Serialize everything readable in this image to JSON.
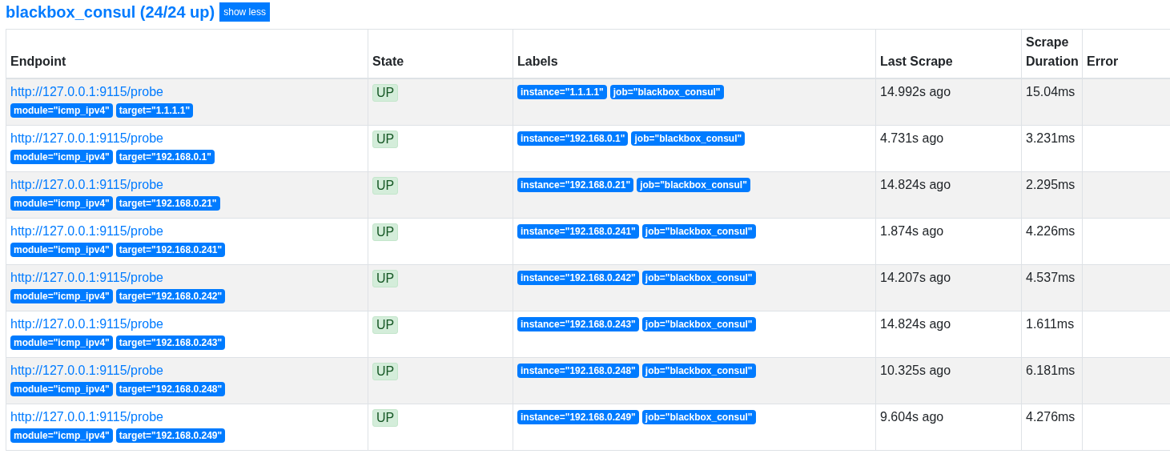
{
  "header": {
    "title": "blackbox_consul (24/24 up)",
    "toggle_button": "show less"
  },
  "table": {
    "columns": [
      "Endpoint",
      "State",
      "Labels",
      "Last Scrape",
      "Scrape Duration",
      "Error"
    ],
    "rows": [
      {
        "endpoint": "http://127.0.0.1:9115/probe",
        "params": [
          "module=\"icmp_ipv4\"",
          "target=\"1.1.1.1\""
        ],
        "state": "UP",
        "labels": [
          "instance=\"1.1.1.1\"",
          "job=\"blackbox_consul\""
        ],
        "last_scrape": "14.992s ago",
        "duration": "15.04ms"
      },
      {
        "endpoint": "http://127.0.0.1:9115/probe",
        "params": [
          "module=\"icmp_ipv4\"",
          "target=\"192.168.0.1\""
        ],
        "state": "UP",
        "labels": [
          "instance=\"192.168.0.1\"",
          "job=\"blackbox_consul\""
        ],
        "last_scrape": "4.731s ago",
        "duration": "3.231ms"
      },
      {
        "endpoint": "http://127.0.0.1:9115/probe",
        "params": [
          "module=\"icmp_ipv4\"",
          "target=\"192.168.0.21\""
        ],
        "state": "UP",
        "labels": [
          "instance=\"192.168.0.21\"",
          "job=\"blackbox_consul\""
        ],
        "last_scrape": "14.824s ago",
        "duration": "2.295ms"
      },
      {
        "endpoint": "http://127.0.0.1:9115/probe",
        "params": [
          "module=\"icmp_ipv4\"",
          "target=\"192.168.0.241\""
        ],
        "state": "UP",
        "labels": [
          "instance=\"192.168.0.241\"",
          "job=\"blackbox_consul\""
        ],
        "last_scrape": "1.874s ago",
        "duration": "4.226ms"
      },
      {
        "endpoint": "http://127.0.0.1:9115/probe",
        "params": [
          "module=\"icmp_ipv4\"",
          "target=\"192.168.0.242\""
        ],
        "state": "UP",
        "labels": [
          "instance=\"192.168.0.242\"",
          "job=\"blackbox_consul\""
        ],
        "last_scrape": "14.207s ago",
        "duration": "4.537ms"
      },
      {
        "endpoint": "http://127.0.0.1:9115/probe",
        "params": [
          "module=\"icmp_ipv4\"",
          "target=\"192.168.0.243\""
        ],
        "state": "UP",
        "labels": [
          "instance=\"192.168.0.243\"",
          "job=\"blackbox_consul\""
        ],
        "last_scrape": "14.824s ago",
        "duration": "1.611ms"
      },
      {
        "endpoint": "http://127.0.0.1:9115/probe",
        "params": [
          "module=\"icmp_ipv4\"",
          "target=\"192.168.0.248\""
        ],
        "state": "UP",
        "labels": [
          "instance=\"192.168.0.248\"",
          "job=\"blackbox_consul\""
        ],
        "last_scrape": "10.325s ago",
        "duration": "6.181ms"
      },
      {
        "endpoint": "http://127.0.0.1:9115/probe",
        "params": [
          "module=\"icmp_ipv4\"",
          "target=\"192.168.0.249\""
        ],
        "state": "UP",
        "labels": [
          "instance=\"192.168.0.249\"",
          "job=\"blackbox_consul\""
        ],
        "last_scrape": "9.604s ago",
        "duration": "4.276ms"
      }
    ]
  }
}
